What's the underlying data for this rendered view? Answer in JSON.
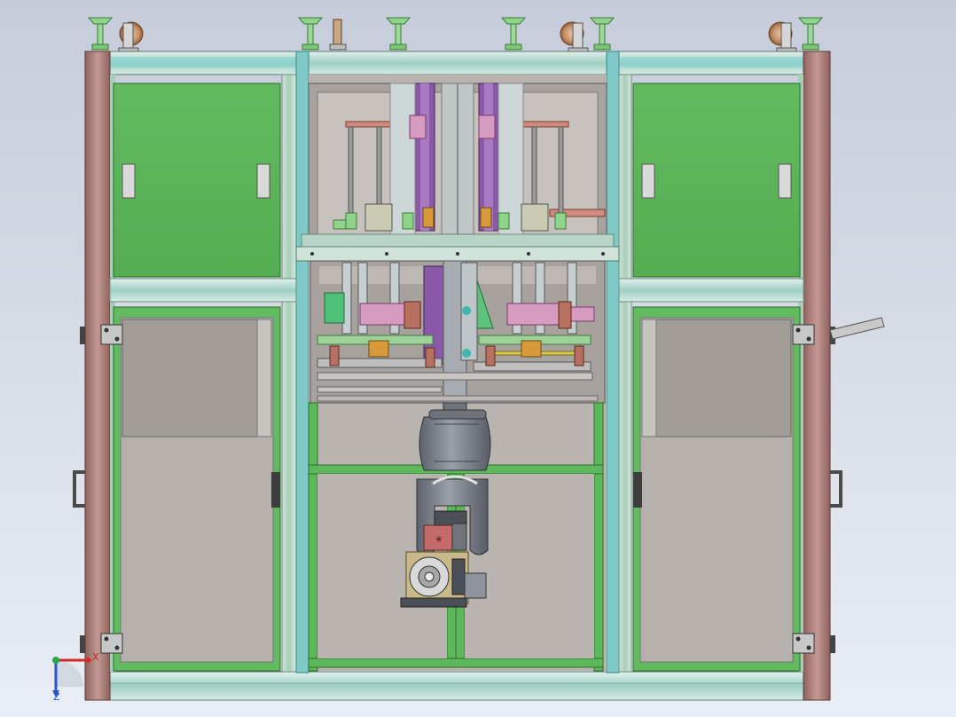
{
  "viewport": {
    "background_top": "#c6ccd9",
    "background_bottom": "#e9edf5"
  },
  "colors": {
    "frame_post": "#b78a85",
    "frame_post_dark": "#6e4d4a",
    "rail": "#b9dcd0",
    "rail_teal": "#74c7c6",
    "panel_green": "#5cb85a",
    "panel_green_light": "#6ec56a",
    "window_gray": "#b8b3ae",
    "window_gray_dark": "#a29d99",
    "robot_gray": "#7b808a",
    "robot_dark": "#4b4f57",
    "slide_purple": "#8a5aa8",
    "beam_salmon": "#d08a7d",
    "accent_orange": "#d99a3a",
    "accent_yellow": "#d9c94a",
    "accent_pink": "#d79bc2",
    "accent_cyan": "#3fb6b1"
  },
  "icons": {
    "leveling_foot": "leveling-foot-icon",
    "caster_wheel": "caster-wheel-icon",
    "door_handle": "door-handle-icon",
    "hinge": "hinge-icon",
    "side_handle": "side-handle-icon",
    "robot_arm": "robot-arm-icon",
    "triad": "coordinate-triad-icon"
  },
  "triad": {
    "x_label": "X",
    "z_label": "Z",
    "x_color": "#d12a2a",
    "z_color": "#2a55c8",
    "y_color": "#2aa84a"
  }
}
